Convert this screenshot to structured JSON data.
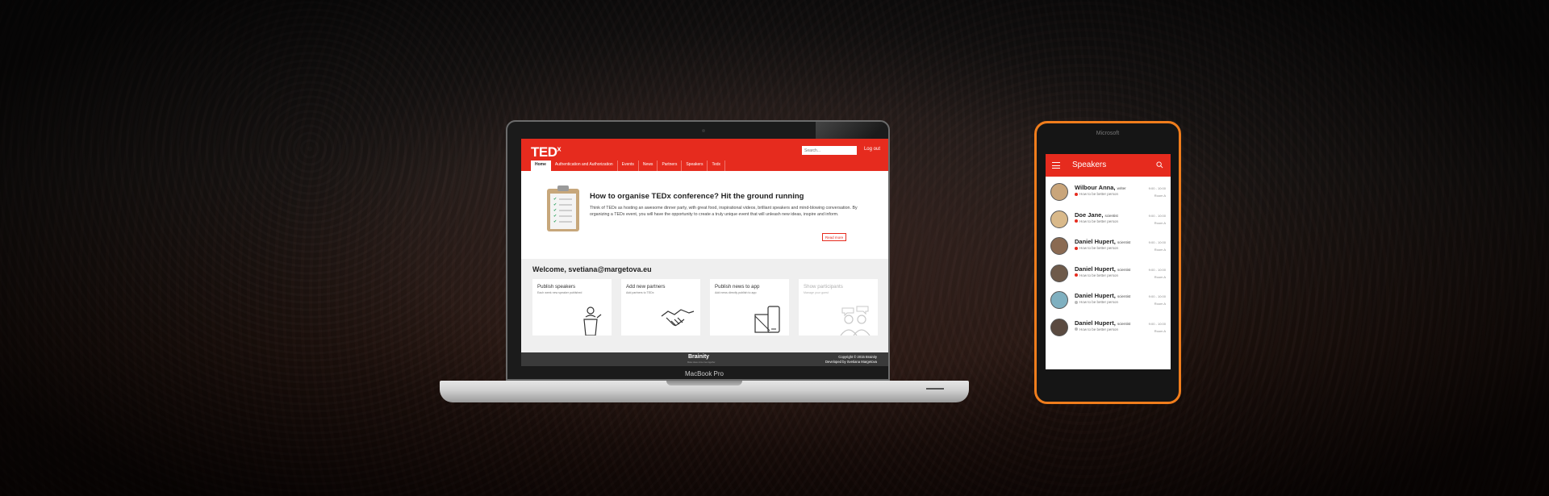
{
  "colors": {
    "ted_red": "#e62b1e",
    "phone_frame": "#f07d1c",
    "footer": "#3a3a3a"
  },
  "laptop": {
    "model_label": "MacBook Pro",
    "site": {
      "logo": "TED",
      "logo_sup": "x",
      "search_placeholder": "Search...",
      "logout": "Log out",
      "nav": [
        "Home",
        "Authentication and Authorization",
        "Events",
        "News",
        "Partners",
        "Speakers",
        "Tedx"
      ],
      "hero": {
        "title": "How to organise TEDx conference? Hit the ground running",
        "text": "Think of TEDx as hosting an awesome dinner party, with great food, inspirational videos, brilliant speakers and mind-blowing conversation. By organizing a TEDx event, you will have the opportunity to create a truly unique event that will unleash new ideas, inspire and inform.",
        "button": "Read more"
      },
      "welcome": "Welcome, svetiana@margetova.eu",
      "cards": [
        {
          "title": "Publish speakers",
          "sub": "Each week new speaker published",
          "icon": "podium-speaker-icon"
        },
        {
          "title": "Add new partners",
          "sub": "Add partners to TEDx",
          "icon": "handshake-icon"
        },
        {
          "title": "Publish news to app",
          "sub": "Add news directly publish to app",
          "icon": "devices-icon"
        },
        {
          "title": "Show participants",
          "sub": "Manage your guest",
          "icon": "participants-chat-icon"
        }
      ],
      "footer": {
        "brand": "Brainity",
        "brand_sub": "Make ideas come true together",
        "copyright": "Copyright © 2015 Brainity",
        "developer": "Developed by Svetiana Margetova"
      }
    }
  },
  "phone": {
    "brand": "Microsoft",
    "app_title": "Speakers",
    "speakers": [
      {
        "name": "Wilbour Anna,",
        "role": "writer",
        "topic": "How to be better person",
        "time": "9:00 - 10:00",
        "room": "Room A",
        "avatar_color": "#c9a57a",
        "dot": "red"
      },
      {
        "name": "Doe Jane,",
        "role": "scientist",
        "topic": "How to be better person",
        "time": "9:00 - 10:00",
        "room": "Room A",
        "avatar_color": "#d9b98a",
        "dot": "red"
      },
      {
        "name": "Daniel Hupert,",
        "role": "scientist",
        "topic": "How to be better person",
        "time": "9:00 - 10:00",
        "room": "Room A",
        "avatar_color": "#8a6a52",
        "dot": "red"
      },
      {
        "name": "Daniel Hupert,",
        "role": "scientist",
        "topic": "How to be better person",
        "time": "9:00 - 10:00",
        "room": "Room A",
        "avatar_color": "#6e5a4a",
        "dot": "red"
      },
      {
        "name": "Daniel Hupert,",
        "role": "scientist",
        "topic": "How to be better person",
        "time": "9:00 - 10:00",
        "room": "Room A",
        "avatar_color": "#7fb0c0",
        "dot": "grey"
      },
      {
        "name": "Daniel Hupert,",
        "role": "scientist",
        "topic": "How to be better person",
        "time": "9:00 - 10:00",
        "room": "Room A",
        "avatar_color": "#5a4a40",
        "dot": "grey"
      }
    ]
  }
}
